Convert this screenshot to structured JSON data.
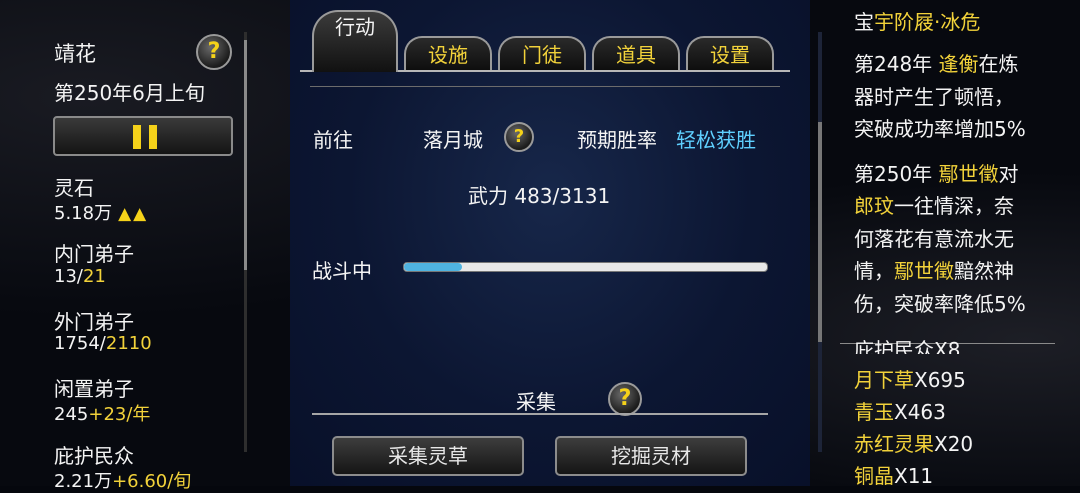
{
  "left": {
    "sect_name": "靖花",
    "date": "第250年6月上旬",
    "stats": [
      {
        "label": "灵石",
        "value": "5.18万",
        "extra": "",
        "trend": "▲▲"
      },
      {
        "label": "内门弟子",
        "value": "13/",
        "extra": "21",
        "trend": ""
      },
      {
        "label": "外门弟子",
        "value": "1754/",
        "extra": "2110",
        "trend": ""
      },
      {
        "label": "闲置弟子",
        "value": "245",
        "extra": "+23/年",
        "trend": ""
      },
      {
        "label": "庇护民众",
        "value": "2.21万",
        "extra": "+6.60/旬",
        "trend": ""
      }
    ]
  },
  "tabs": [
    {
      "label": "行动",
      "active": true
    },
    {
      "label": "设施",
      "active": false
    },
    {
      "label": "门徒",
      "active": false
    },
    {
      "label": "道具",
      "active": false
    },
    {
      "label": "设置",
      "active": false
    }
  ],
  "action": {
    "goto_label": "前往",
    "destination": "落月城",
    "win_rate_label": "预期胜率",
    "win_rate_value": "轻松获胜",
    "power": "武力 483/3131",
    "battle_label": "战斗中",
    "battle_progress": 0.16,
    "gather_label": "采集",
    "btn_herbs": "采集灵草",
    "btn_dig": "挖掘灵材"
  },
  "log": {
    "title_prefix": "宝",
    "title_name": "宇阶屐·冰危",
    "entries": [
      [
        {
          "t": "第248年 ",
          "c": "w"
        },
        {
          "t": "逢衡",
          "c": "y"
        },
        {
          "t": "在炼",
          "c": "w"
        }
      ],
      [
        {
          "t": "器时产生了顿悟，",
          "c": "w"
        }
      ],
      [
        {
          "t": "突破成功率增加5%",
          "c": "w"
        }
      ],
      [
        {
          "t": "第250年 ",
          "c": "w"
        },
        {
          "t": "鄢世徵",
          "c": "y"
        },
        {
          "t": "对",
          "c": "w"
        }
      ],
      [
        {
          "t": "郎玟",
          "c": "y"
        },
        {
          "t": "一往情深，奈",
          "c": "w"
        }
      ],
      [
        {
          "t": "何落花有意流水无",
          "c": "w"
        }
      ],
      [
        {
          "t": "情，",
          "c": "w"
        },
        {
          "t": "鄢世徵",
          "c": "y"
        },
        {
          "t": "黯然神",
          "c": "w"
        }
      ],
      [
        {
          "t": "伤，突破率降低5%",
          "c": "w"
        }
      ]
    ],
    "cut_line": "庇护民众X8",
    "items": [
      {
        "name": "月下草",
        "count": "X695"
      },
      {
        "name": "青玉",
        "count": "X463"
      },
      {
        "name": "赤红灵果",
        "count": "X20"
      },
      {
        "name": "铜晶",
        "count": "X11"
      }
    ]
  },
  "colors": {
    "accent_yellow": "#f2d23a",
    "cyan": "#5fd0ff",
    "panel_blue": "#0c1632"
  }
}
